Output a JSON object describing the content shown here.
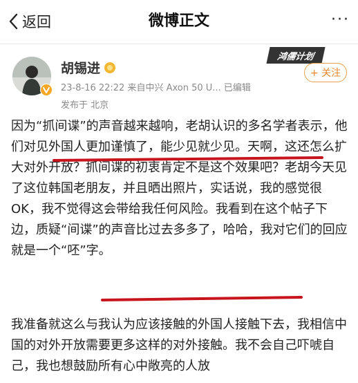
{
  "nav": {
    "back_label": "返回",
    "title": "微博正文",
    "more_label": "···"
  },
  "post": {
    "author": "胡锡进",
    "meta": "23-8-16 22:22  来自中兴 Axon 50 U...  已编辑",
    "location": "发布于 北京",
    "tag": "鸿儒计划",
    "follow_label": "+ 关注",
    "paragraph1": "因为“抓间谍”的声音越来越响，老胡认识的多名学者表示，他们对见外国人更加谨慎了，能少见就少见。天啊，这还怎么扩大对外开放？抓间谍的初衷肯定不是这个效果吧？老胡今天见了这位韩国老朋友，并且晒出照片，实话说，我的感觉很OK，我不觉得这会带给我任何风险。我看到在这个帖子下边，质疑“间谍”的声音比过去多多了，哈哈，我对它们的回应就是一个“呸”字。",
    "paragraph2": "我准备就这么与我认为应该接触的外国人接触下去，我相信中国的对外开放需要更多这样的对外接触。我不会自己吓唬自己，我也想鼓励所有心中敞亮的人放"
  },
  "colors": {
    "underline": "#c8141d",
    "follow": "#e8872e",
    "meta": "#8a8a8a"
  }
}
